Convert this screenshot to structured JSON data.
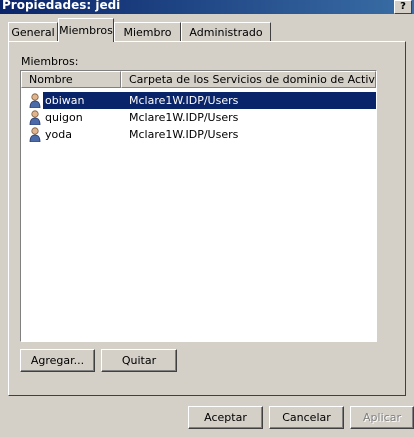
{
  "window": {
    "title": "Propiedades: jedi",
    "help_label": "?"
  },
  "tabs": [
    {
      "label": "General"
    },
    {
      "label": "Miembros"
    },
    {
      "label": "Miembro de"
    },
    {
      "label": "Administrado por"
    }
  ],
  "active_tab": "Miembros",
  "members": {
    "label": "Miembros:",
    "columns": {
      "name": "Nombre",
      "folder": "Carpeta de los Servicios de dominio de Active Dir..."
    },
    "rows": [
      {
        "name": "obiwan",
        "folder": "Mclare1W.IDP/Users",
        "selected": true
      },
      {
        "name": "quigon",
        "folder": "Mclare1W.IDP/Users",
        "selected": false
      },
      {
        "name": "yoda",
        "folder": "Mclare1W.IDP/Users",
        "selected": false
      }
    ],
    "add_label": "Agregar...",
    "remove_label": "Quitar"
  },
  "footer": {
    "ok_label": "Aceptar",
    "cancel_label": "Cancelar",
    "apply_label": "Aplicar"
  },
  "colors": {
    "titlebar": "#0a246a",
    "selection": "#0a246a",
    "face": "#d4d0c8"
  },
  "icons": {
    "row": "user-icon"
  }
}
